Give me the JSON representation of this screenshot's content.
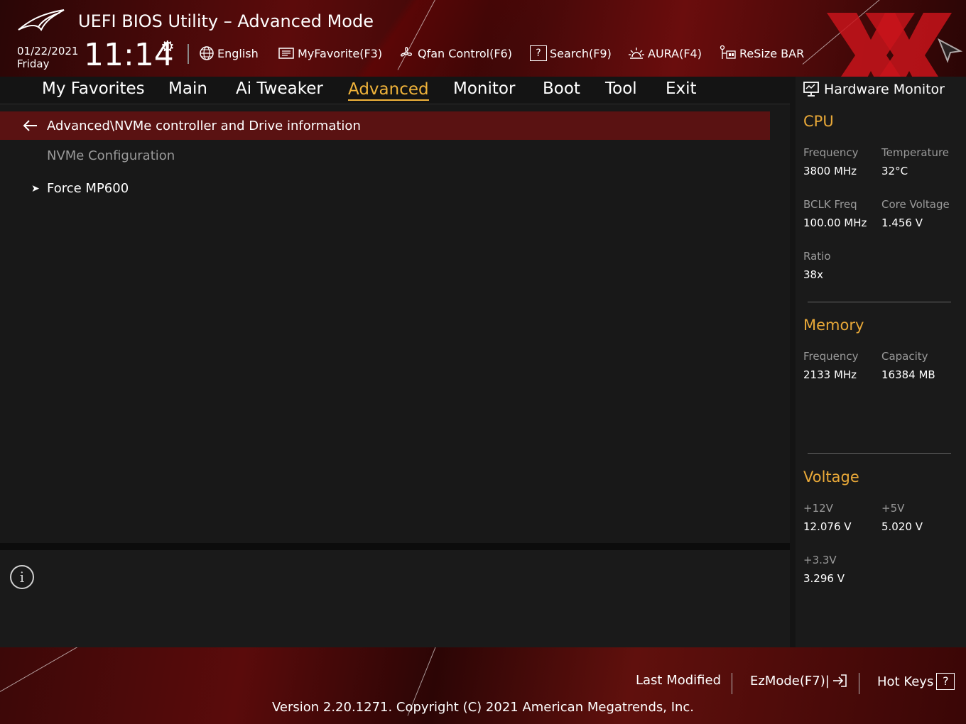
{
  "header": {
    "title": "UEFI BIOS Utility – Advanced Mode",
    "date": "01/22/2021",
    "day": "Friday",
    "time": "11:14",
    "toolbar": {
      "language": "English",
      "favorite": "MyFavorite(F3)",
      "qfan": "Qfan Control(F6)",
      "search": "Search(F9)",
      "aura": "AURA(F4)",
      "resize_bar": "ReSize BAR"
    }
  },
  "tabs": [
    "My Favorites",
    "Main",
    "Ai Tweaker",
    "Advanced",
    "Monitor",
    "Boot",
    "Tool",
    "Exit"
  ],
  "active_tab": "Advanced",
  "main": {
    "breadcrumb": "Advanced\\NVMe controller and Drive information",
    "section_label": "NVMe Configuration",
    "items": [
      "Force MP600"
    ]
  },
  "hardware_monitor": {
    "title": "Hardware Monitor",
    "cpu": {
      "heading": "CPU",
      "frequency_label": "Frequency",
      "frequency": "3800 MHz",
      "temperature_label": "Temperature",
      "temperature": "32°C",
      "bclk_label": "BCLK Freq",
      "bclk": "100.00 MHz",
      "core_voltage_label": "Core Voltage",
      "core_voltage": "1.456 V",
      "ratio_label": "Ratio",
      "ratio": "38x"
    },
    "memory": {
      "heading": "Memory",
      "frequency_label": "Frequency",
      "frequency": "2133 MHz",
      "capacity_label": "Capacity",
      "capacity": "16384 MB"
    },
    "voltage": {
      "heading": "Voltage",
      "v12_label": "+12V",
      "v12": "12.076 V",
      "v5_label": "+5V",
      "v5": "5.020 V",
      "v33_label": "+3.3V",
      "v33": "3.296 V"
    }
  },
  "footer": {
    "last_modified": "Last Modified",
    "ezmode": "EzMode(F7)|",
    "hotkeys": "Hot Keys",
    "hotkeys_icon": "?",
    "version": "Version 2.20.1271. Copyright (C) 2021 American Megatrends, Inc."
  },
  "colors": {
    "accent": "#f0b33a",
    "section_heading": "#e8a838",
    "breadcrumb_bg": "#5a1212",
    "brand_red": "#c8141b"
  },
  "icons": [
    "rog-logo",
    "gear-icon",
    "globe-icon",
    "favorite-icon",
    "fan-icon",
    "search-icon",
    "aura-icon",
    "resize-bar-icon",
    "back-arrow-icon",
    "chevron-right-icon",
    "info-icon",
    "monitor-icon",
    "exit-icon",
    "help-icon"
  ]
}
